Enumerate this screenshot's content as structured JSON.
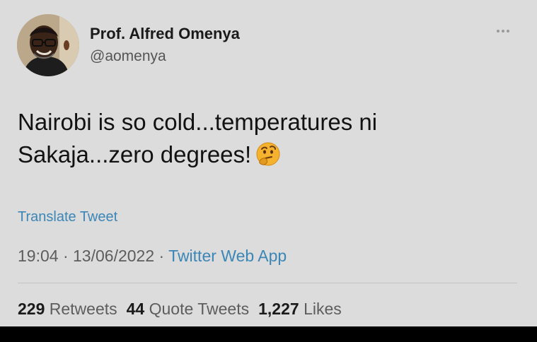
{
  "author": {
    "name": "Prof. Alfred Omenya",
    "handle": "@aomenya",
    "avatar_icon": "avatar-photo"
  },
  "tweet": {
    "line1": "Nairobi is so cold...temperatures ni",
    "line2": "Sakaja...zero degrees!",
    "emoji_icon": "thinking-face-emoji",
    "translate_label": "Translate Tweet"
  },
  "meta": {
    "time": "19:04",
    "date": "13/06/2022",
    "separator": " · ",
    "source": "Twitter Web App"
  },
  "stats": {
    "retweets_count": "229",
    "retweets_label": "Retweets",
    "quotes_count": "44",
    "quotes_label": "Quote Tweets",
    "likes_count": "1,227",
    "likes_label": "Likes"
  },
  "colors": {
    "background": "#dcdcdc",
    "link": "#3b86b7",
    "text": "#121212",
    "muted": "#5d5d5d"
  }
}
